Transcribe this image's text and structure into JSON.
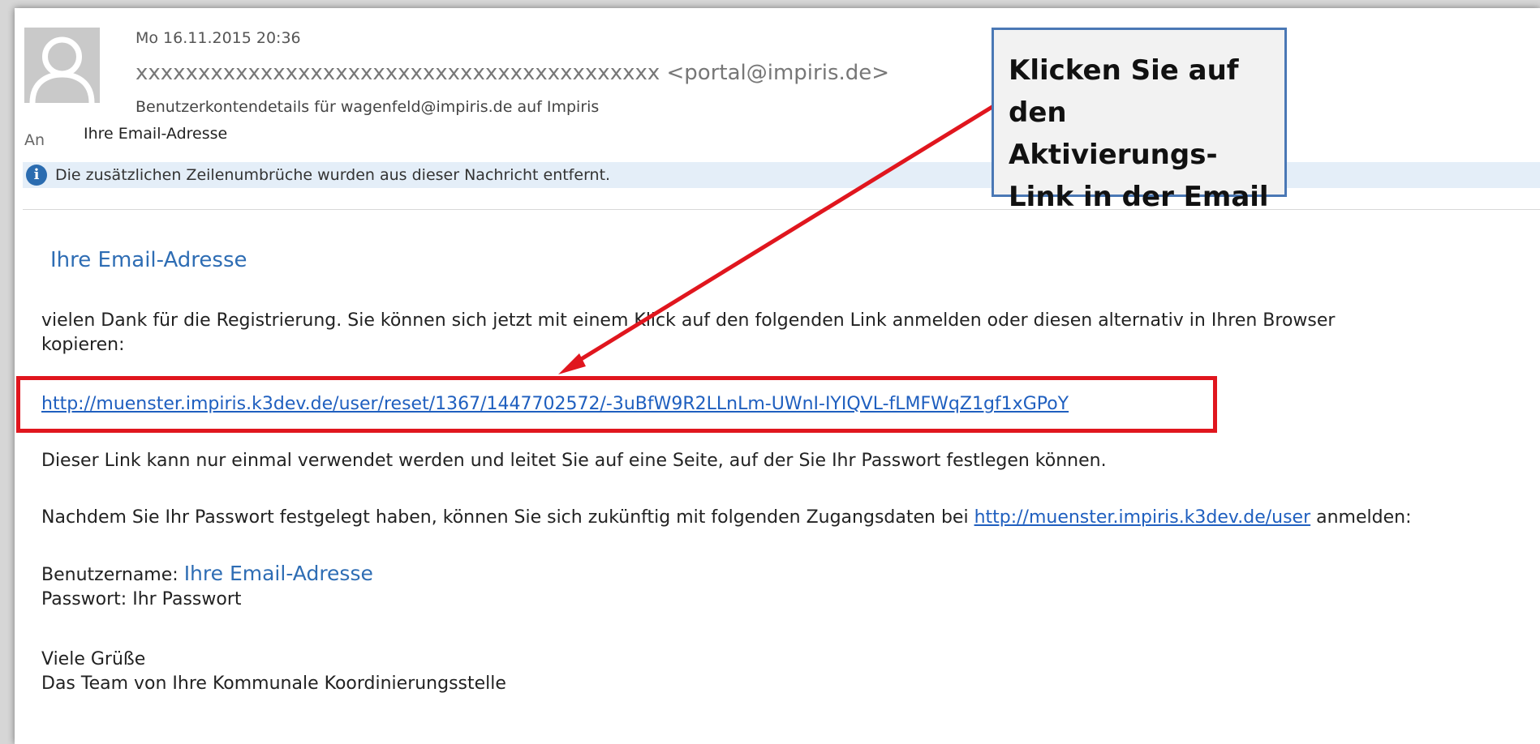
{
  "header": {
    "date": "Mo 16.11.2015 20:36",
    "sender_name": "xxxxxxxxxxxxxxxxxxxxxxxxxxxxxxxxxxxxxxxxxx",
    "sender_email": "<portal@impiris.de>",
    "subject": "Benutzerkontendetails für wagenfeld@impiris.de auf Impiris",
    "to_label": "An",
    "to_value": "Ihre Email-Adresse"
  },
  "infobar": {
    "text": "Die zusätzlichen Zeilenumbrüche wurden aus dieser Nachricht entfernt."
  },
  "email": {
    "greeting": "Ihre Email-Adresse",
    "paragraph1_line1": "vielen Dank für die Registrierung. Sie können sich jetzt mit einem Klick auf den folgenden Link anmelden oder diesen alternativ in Ihren Browser",
    "paragraph1_line2": "kopieren:",
    "activation_link": "http://muenster.impiris.k3dev.de/user/reset/1367/1447702572/-3uBfW9R2LLnLm-UWnI-IYIQVL-fLMFWqZ1gf1xGPoY",
    "paragraph2": "Dieser Link kann nur einmal verwendet werden und leitet Sie auf eine Seite, auf der Sie Ihr Passwort festlegen können.",
    "paragraph3_before": "Nachdem Sie Ihr Passwort festgelegt haben, können Sie sich zukünftig mit folgenden Zugangsdaten bei ",
    "paragraph3_link": "http://muenster.impiris.k3dev.de/user",
    "paragraph3_after": " anmelden:",
    "username_label": "Benutzername: ",
    "username_value": "Ihre Email-Adresse",
    "password_line": "Passwort: Ihr Passwort",
    "closing1": "Viele Grüße",
    "closing2": "Das Team von Ihre Kommunale Koordinierungsstelle"
  },
  "callout": {
    "line1": "Klicken Sie auf",
    "line2": "den Aktivierungs-",
    "line3": "Link in der Email"
  },
  "colors": {
    "highlight": "#e0161e",
    "callout_border": "#4a78b5",
    "link": "#1f5fbf",
    "infobar": "#e4eef8"
  }
}
